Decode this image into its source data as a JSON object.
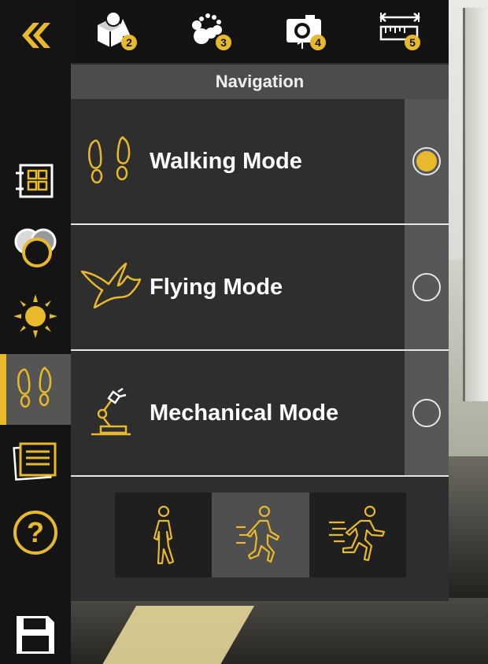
{
  "panel": {
    "title": "Navigation",
    "modes": [
      {
        "label": "Walking Mode",
        "icon": "footprints-icon",
        "selected": true
      },
      {
        "label": "Flying Mode",
        "icon": "bird-icon",
        "selected": false
      },
      {
        "label": "Mechanical Mode",
        "icon": "robot-arm-icon",
        "selected": false
      }
    ]
  },
  "toolbar": {
    "badges": [
      "2",
      "3",
      "4",
      "5"
    ],
    "icons": [
      "shapes-icon",
      "nodes-icon",
      "camera-icon",
      "ruler-icon"
    ]
  },
  "sidebar": {
    "icons": [
      "collapse-icon",
      "floorplan-icon",
      "materials-icon",
      "sun-icon",
      "navigation-icon",
      "notes-icon",
      "help-icon",
      "save-icon"
    ],
    "help_label": "?"
  },
  "speed": {
    "options": [
      "walk-speed-icon",
      "jog-speed-icon",
      "run-speed-icon"
    ],
    "selected_index": 1
  },
  "colors": {
    "accent": "#e8b92b",
    "panel": "#2e2e2e",
    "sidebar": "#141414"
  }
}
